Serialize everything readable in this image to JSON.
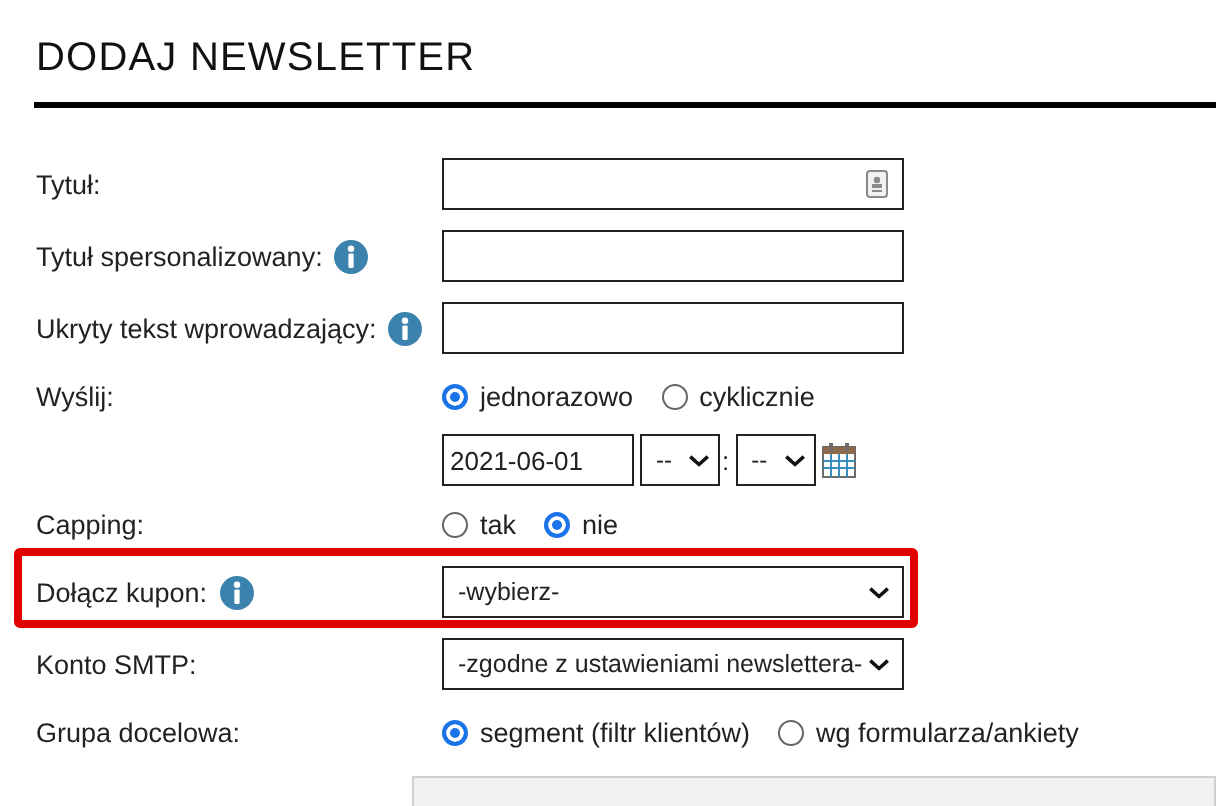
{
  "title": "DODAJ NEWSLETTER",
  "fields": [
    {
      "kind": "text",
      "label": "Tytuł:",
      "info": false,
      "field_icon": true,
      "highlighted": false
    },
    {
      "kind": "text",
      "label": "Tytuł spersonalizowany:",
      "info": true,
      "field_icon": false,
      "highlighted": false
    },
    {
      "kind": "text",
      "label": "Ukryty tekst wprowadzający:",
      "info": true,
      "field_icon": false,
      "highlighted": false
    },
    {
      "kind": "radio",
      "label": "Wyślij:",
      "info": false,
      "highlighted": false,
      "options": [
        {
          "label": "jednorazowo",
          "selected": true
        },
        {
          "label": "cyklicznie",
          "selected": false
        }
      ]
    },
    {
      "kind": "datetime",
      "date": "2021-06-01",
      "hour": "--",
      "separator": ":",
      "minute": "--",
      "highlighted": false
    },
    {
      "kind": "radio",
      "label": "Capping:",
      "info": false,
      "highlighted": false,
      "options": [
        {
          "label": "tak",
          "selected": false
        },
        {
          "label": "nie",
          "selected": true
        }
      ]
    },
    {
      "kind": "select",
      "label": "Dołącz kupon:",
      "info": true,
      "value": "-wybierz-",
      "highlighted": true
    },
    {
      "kind": "select",
      "label": "Konto SMTP:",
      "info": false,
      "value": "-zgodne z ustawieniami newslettera-",
      "highlighted": false
    },
    {
      "kind": "radio",
      "label": "Grupa docelowa:",
      "info": false,
      "highlighted": false,
      "options": [
        {
          "label": "segment (filtr klientów)",
          "selected": true
        },
        {
          "label": "wg formularza/ankiety",
          "selected": false
        }
      ]
    }
  ]
}
